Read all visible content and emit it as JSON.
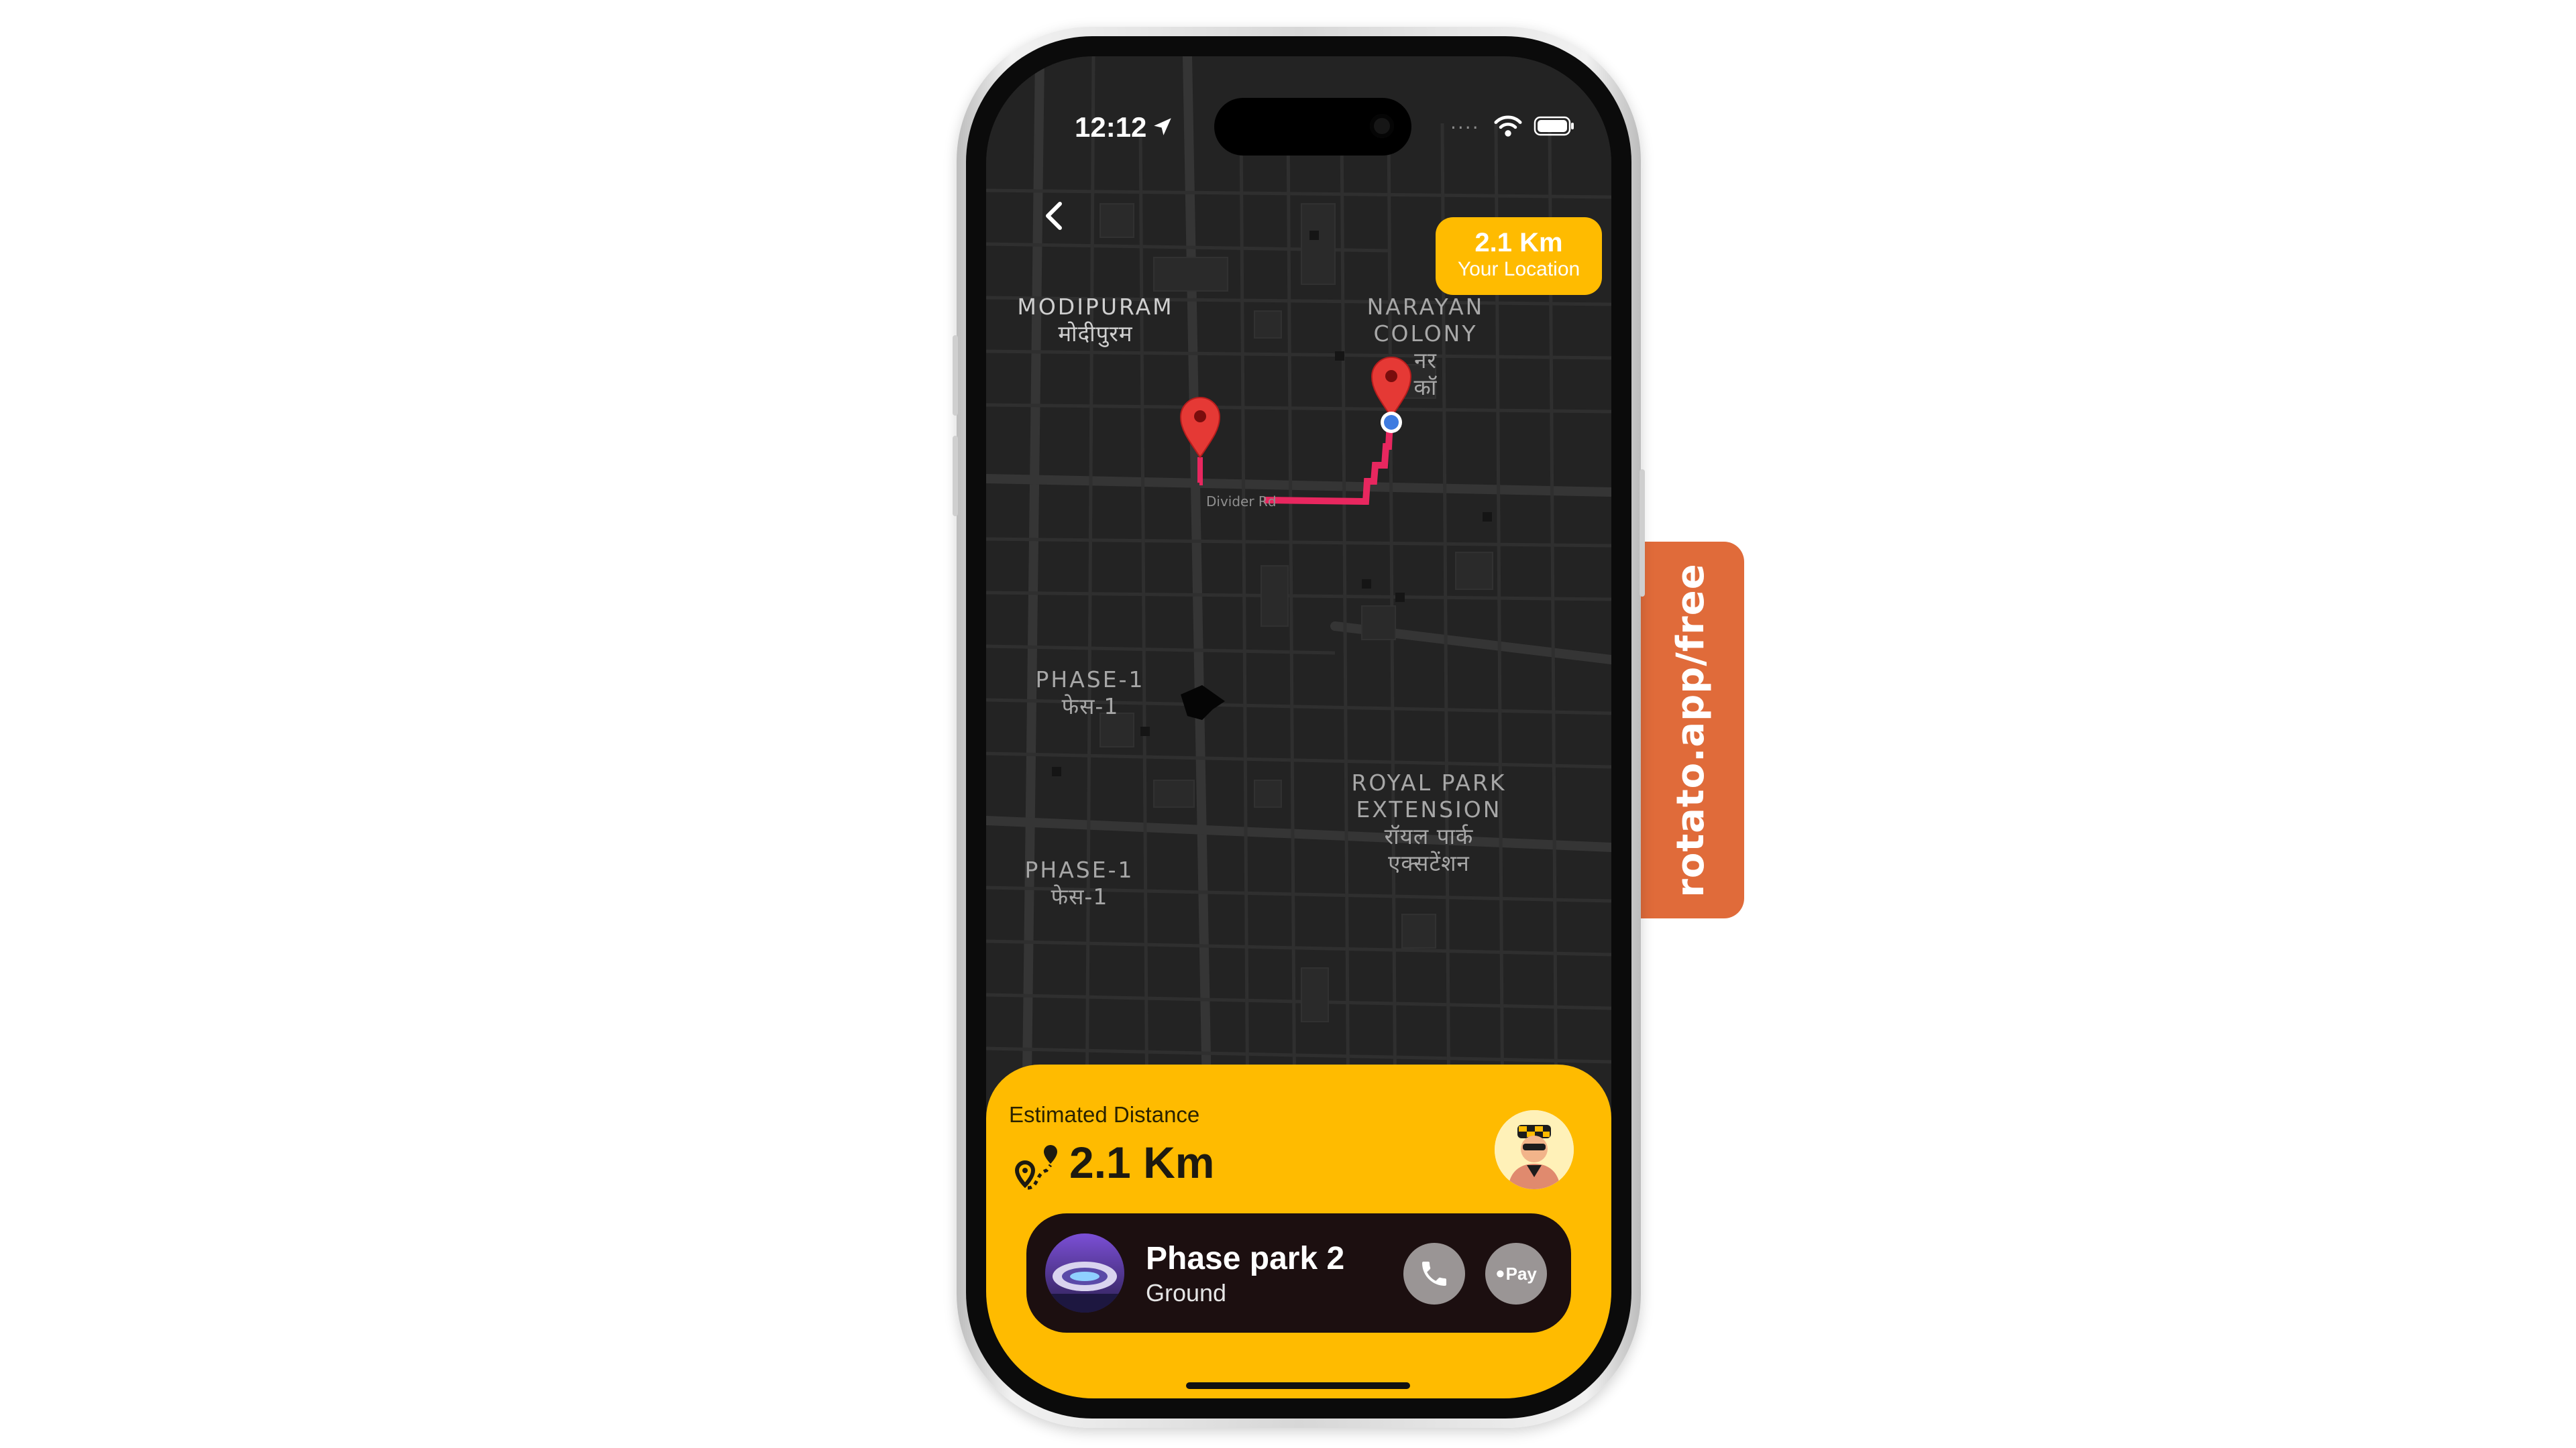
{
  "promo": {
    "text": "rotato.app/free",
    "color": "#E06B3A"
  },
  "status_bar": {
    "time": "12:12",
    "icons": [
      "location-arrow-icon",
      "wifi-icon",
      "battery-icon"
    ]
  },
  "map": {
    "labels": {
      "modipuram_en": "MODIPURAM",
      "modipuram_hi": "मोदीपुरम",
      "narayan_en_1": "NARAYAN",
      "narayan_en_2": "COLONY",
      "narayan_hi_1": "नर",
      "narayan_hi_2": "कॉ",
      "phase1a_en": "PHASE-1",
      "phase1a_hi": "फेस-1",
      "phase1b_en": "PHASE-1",
      "phase1b_hi": "फेस-1",
      "royal_en_1": "ROYAL PARK",
      "royal_en_2": "EXTENSION",
      "royal_hi_1": "रॉयल पार्क",
      "royal_hi_2": "एक्सटेंशन",
      "road": "Divider Rd"
    },
    "route_color": "#E8275F",
    "pin_color": "#E53935",
    "user_dot_color": "#3E7BE0"
  },
  "callout": {
    "value": "2.1 Km",
    "label": "Your Location"
  },
  "sheet": {
    "label": "Estimated Distance",
    "distance": "2.1 Km",
    "accent": "#FFBB00"
  },
  "place": {
    "name": "Phase park 2",
    "subtitle": "Ground",
    "pay_label": "Pay"
  }
}
